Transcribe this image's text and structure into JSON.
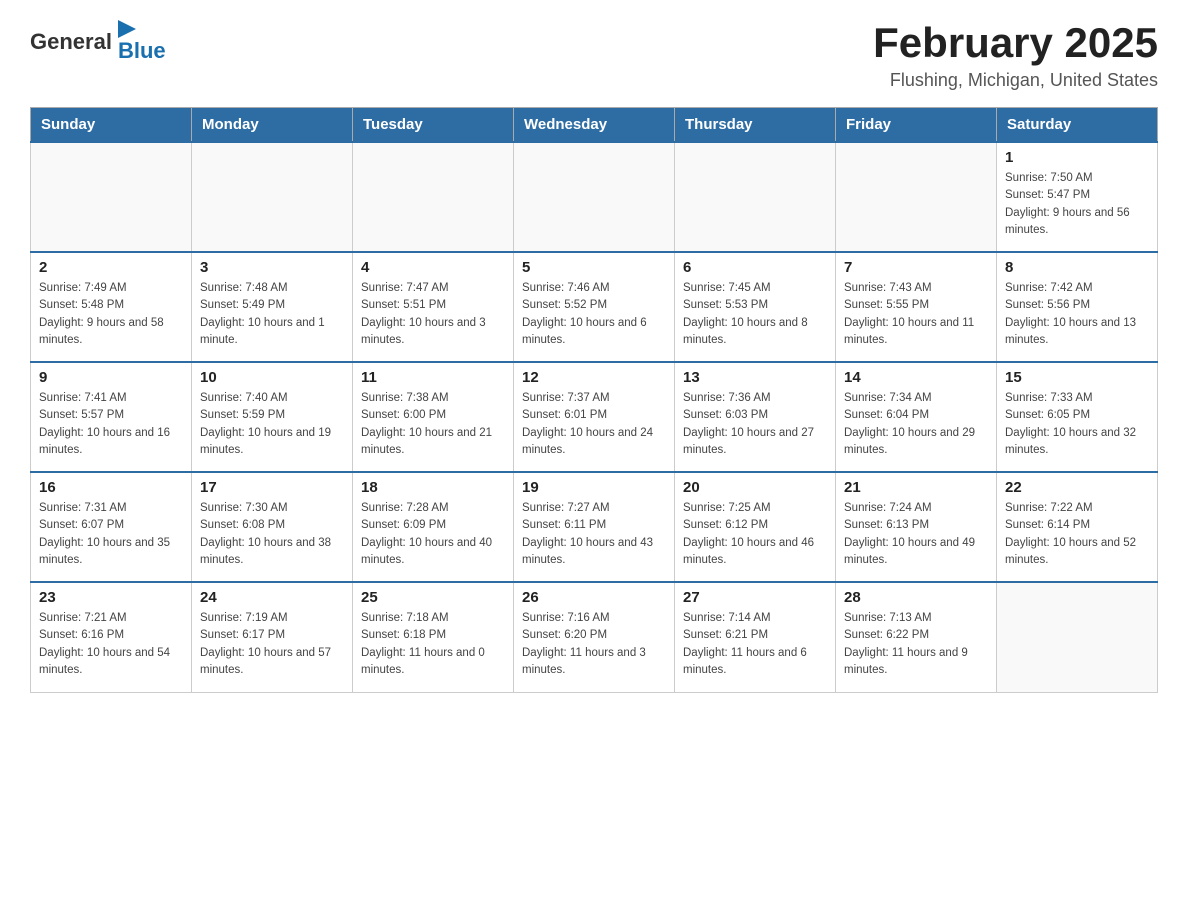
{
  "header": {
    "logo_general": "General",
    "logo_blue": "Blue",
    "month_year": "February 2025",
    "location": "Flushing, Michigan, United States"
  },
  "weekdays": [
    "Sunday",
    "Monday",
    "Tuesday",
    "Wednesday",
    "Thursday",
    "Friday",
    "Saturday"
  ],
  "weeks": [
    [
      {
        "day": "",
        "info": ""
      },
      {
        "day": "",
        "info": ""
      },
      {
        "day": "",
        "info": ""
      },
      {
        "day": "",
        "info": ""
      },
      {
        "day": "",
        "info": ""
      },
      {
        "day": "",
        "info": ""
      },
      {
        "day": "1",
        "info": "Sunrise: 7:50 AM\nSunset: 5:47 PM\nDaylight: 9 hours and 56 minutes."
      }
    ],
    [
      {
        "day": "2",
        "info": "Sunrise: 7:49 AM\nSunset: 5:48 PM\nDaylight: 9 hours and 58 minutes."
      },
      {
        "day": "3",
        "info": "Sunrise: 7:48 AM\nSunset: 5:49 PM\nDaylight: 10 hours and 1 minute."
      },
      {
        "day": "4",
        "info": "Sunrise: 7:47 AM\nSunset: 5:51 PM\nDaylight: 10 hours and 3 minutes."
      },
      {
        "day": "5",
        "info": "Sunrise: 7:46 AM\nSunset: 5:52 PM\nDaylight: 10 hours and 6 minutes."
      },
      {
        "day": "6",
        "info": "Sunrise: 7:45 AM\nSunset: 5:53 PM\nDaylight: 10 hours and 8 minutes."
      },
      {
        "day": "7",
        "info": "Sunrise: 7:43 AM\nSunset: 5:55 PM\nDaylight: 10 hours and 11 minutes."
      },
      {
        "day": "8",
        "info": "Sunrise: 7:42 AM\nSunset: 5:56 PM\nDaylight: 10 hours and 13 minutes."
      }
    ],
    [
      {
        "day": "9",
        "info": "Sunrise: 7:41 AM\nSunset: 5:57 PM\nDaylight: 10 hours and 16 minutes."
      },
      {
        "day": "10",
        "info": "Sunrise: 7:40 AM\nSunset: 5:59 PM\nDaylight: 10 hours and 19 minutes."
      },
      {
        "day": "11",
        "info": "Sunrise: 7:38 AM\nSunset: 6:00 PM\nDaylight: 10 hours and 21 minutes."
      },
      {
        "day": "12",
        "info": "Sunrise: 7:37 AM\nSunset: 6:01 PM\nDaylight: 10 hours and 24 minutes."
      },
      {
        "day": "13",
        "info": "Sunrise: 7:36 AM\nSunset: 6:03 PM\nDaylight: 10 hours and 27 minutes."
      },
      {
        "day": "14",
        "info": "Sunrise: 7:34 AM\nSunset: 6:04 PM\nDaylight: 10 hours and 29 minutes."
      },
      {
        "day": "15",
        "info": "Sunrise: 7:33 AM\nSunset: 6:05 PM\nDaylight: 10 hours and 32 minutes."
      }
    ],
    [
      {
        "day": "16",
        "info": "Sunrise: 7:31 AM\nSunset: 6:07 PM\nDaylight: 10 hours and 35 minutes."
      },
      {
        "day": "17",
        "info": "Sunrise: 7:30 AM\nSunset: 6:08 PM\nDaylight: 10 hours and 38 minutes."
      },
      {
        "day": "18",
        "info": "Sunrise: 7:28 AM\nSunset: 6:09 PM\nDaylight: 10 hours and 40 minutes."
      },
      {
        "day": "19",
        "info": "Sunrise: 7:27 AM\nSunset: 6:11 PM\nDaylight: 10 hours and 43 minutes."
      },
      {
        "day": "20",
        "info": "Sunrise: 7:25 AM\nSunset: 6:12 PM\nDaylight: 10 hours and 46 minutes."
      },
      {
        "day": "21",
        "info": "Sunrise: 7:24 AM\nSunset: 6:13 PM\nDaylight: 10 hours and 49 minutes."
      },
      {
        "day": "22",
        "info": "Sunrise: 7:22 AM\nSunset: 6:14 PM\nDaylight: 10 hours and 52 minutes."
      }
    ],
    [
      {
        "day": "23",
        "info": "Sunrise: 7:21 AM\nSunset: 6:16 PM\nDaylight: 10 hours and 54 minutes."
      },
      {
        "day": "24",
        "info": "Sunrise: 7:19 AM\nSunset: 6:17 PM\nDaylight: 10 hours and 57 minutes."
      },
      {
        "day": "25",
        "info": "Sunrise: 7:18 AM\nSunset: 6:18 PM\nDaylight: 11 hours and 0 minutes."
      },
      {
        "day": "26",
        "info": "Sunrise: 7:16 AM\nSunset: 6:20 PM\nDaylight: 11 hours and 3 minutes."
      },
      {
        "day": "27",
        "info": "Sunrise: 7:14 AM\nSunset: 6:21 PM\nDaylight: 11 hours and 6 minutes."
      },
      {
        "day": "28",
        "info": "Sunrise: 7:13 AM\nSunset: 6:22 PM\nDaylight: 11 hours and 9 minutes."
      },
      {
        "day": "",
        "info": ""
      }
    ]
  ]
}
